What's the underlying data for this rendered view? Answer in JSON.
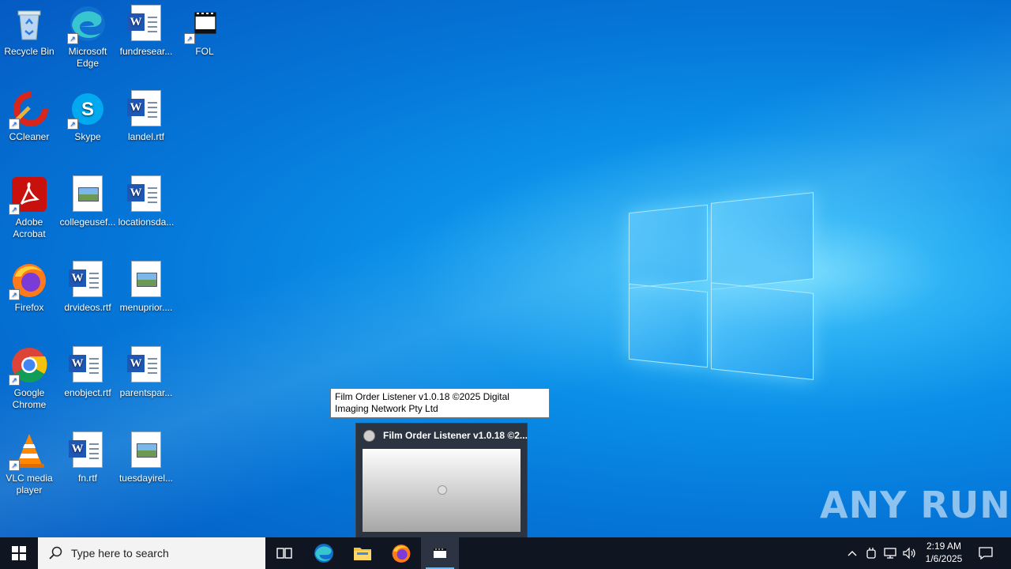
{
  "desktop": {
    "icons": [
      {
        "label": "Recycle Bin",
        "icon": "recycle-bin-icon"
      },
      {
        "label": "Microsoft Edge",
        "icon": "edge-icon"
      },
      {
        "label": "fundresear...",
        "icon": "word-doc-icon"
      },
      {
        "label": "FOL",
        "icon": "film-app-icon"
      },
      {
        "label": "CCleaner",
        "icon": "ccleaner-icon"
      },
      {
        "label": "Skype",
        "icon": "skype-icon"
      },
      {
        "label": "landel.rtf",
        "icon": "word-doc-icon"
      },
      {
        "label": "Adobe Acrobat",
        "icon": "acrobat-icon"
      },
      {
        "label": "collegeusef...",
        "icon": "image-file-icon"
      },
      {
        "label": "locationsda...",
        "icon": "word-doc-icon"
      },
      {
        "label": "Firefox",
        "icon": "firefox-icon"
      },
      {
        "label": "drvideos.rtf",
        "icon": "word-doc-icon"
      },
      {
        "label": "menuprior....",
        "icon": "image-file-icon"
      },
      {
        "label": "Google Chrome",
        "icon": "chrome-icon"
      },
      {
        "label": "enobject.rtf",
        "icon": "word-doc-icon"
      },
      {
        "label": "parentspar...",
        "icon": "word-doc-icon"
      },
      {
        "label": "VLC media player",
        "icon": "vlc-icon"
      },
      {
        "label": "fn.rtf",
        "icon": "word-doc-icon"
      },
      {
        "label": "tuesdayirel...",
        "icon": "image-file-icon"
      }
    ]
  },
  "tooltip": {
    "text": "Film Order Listener  v1.0.18 ©2025 Digital Imaging Network Pty Ltd"
  },
  "preview": {
    "title": "Film Order Listener  v1.0.18 ©2..."
  },
  "watermark": {
    "text": "ANY RUN"
  },
  "taskbar": {
    "search_placeholder": "Type here to search",
    "clock_time": "2:19 AM",
    "clock_date": "1/6/2025"
  },
  "colors": {
    "taskbar_bg": "#101621",
    "accent": "#76b9ed"
  }
}
